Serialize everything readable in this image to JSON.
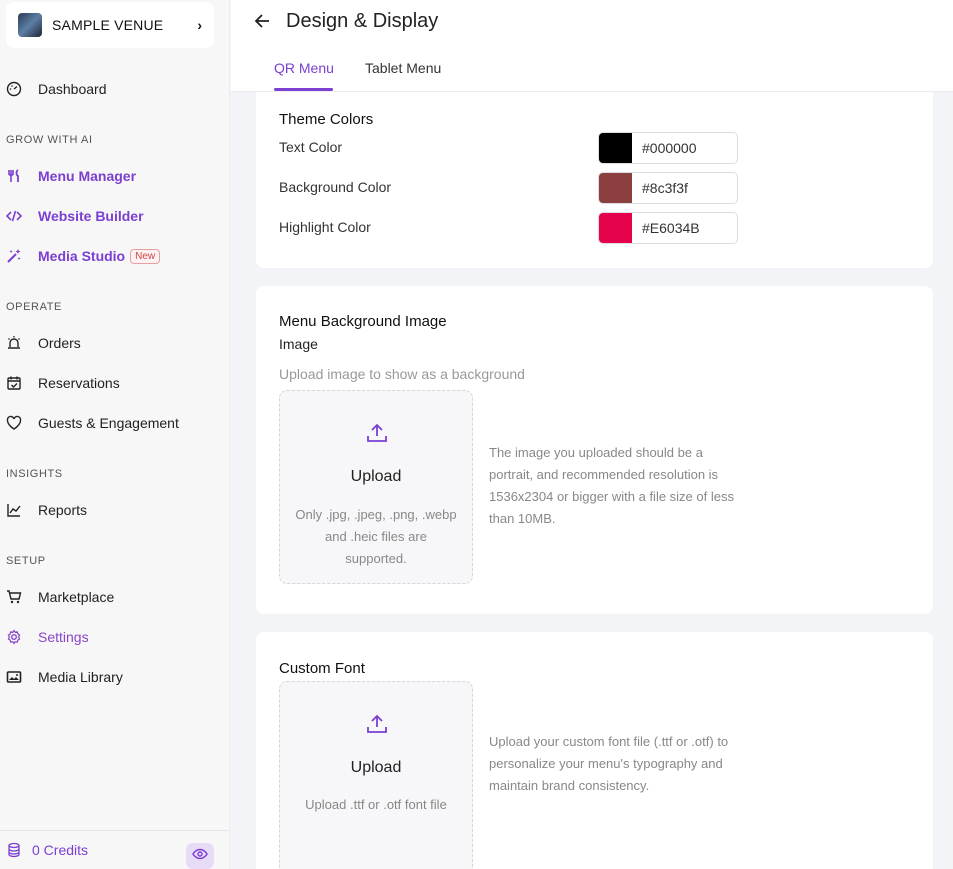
{
  "sidebar": {
    "venue_name": "SAMPLE VENUE",
    "sections": {
      "grow": "GROW WITH AI",
      "operate": "OPERATE",
      "insights": "INSIGHTS",
      "setup": "SETUP"
    },
    "items": {
      "dashboard": "Dashboard",
      "menu_manager": "Menu Manager",
      "website_builder": "Website Builder",
      "media_studio": "Media Studio",
      "media_studio_badge": "New",
      "orders": "Orders",
      "reservations": "Reservations",
      "guests": "Guests & Engagement",
      "reports": "Reports",
      "marketplace": "Marketplace",
      "settings": "Settings",
      "media_library": "Media Library"
    },
    "credits": "0 Credits"
  },
  "header": {
    "title": "Design & Display",
    "tabs": [
      "QR Menu",
      "Tablet Menu"
    ],
    "active_tab": "QR Menu"
  },
  "theme_colors": {
    "title": "Theme Colors",
    "rows": [
      {
        "label": "Text Color",
        "value": "#000000",
        "swatch": "#000000"
      },
      {
        "label": "Background Color",
        "value": "#8c3f3f",
        "swatch": "#8c3f3f"
      },
      {
        "label": "Highlight Color",
        "value": "#E6034B",
        "swatch": "#E6034B"
      }
    ]
  },
  "background_image": {
    "title": "Menu Background Image",
    "field_label": "Image",
    "hint": "Upload image to show as a background",
    "upload_label": "Upload",
    "upload_sub": "Only .jpg, .jpeg, .png, .webp and .heic files are supported.",
    "help": "The image you uploaded should be a portrait, and recommended resolution is 1536x2304 or bigger with a file size of less than 10MB."
  },
  "custom_font": {
    "title": "Custom Font",
    "upload_label": "Upload",
    "upload_sub": "Upload .ttf or .otf font file",
    "help": "Upload your custom font file (.ttf or .otf) to personalize your menu's typography and maintain brand consistency."
  },
  "colors": {
    "accent": "#7b3fd1"
  }
}
